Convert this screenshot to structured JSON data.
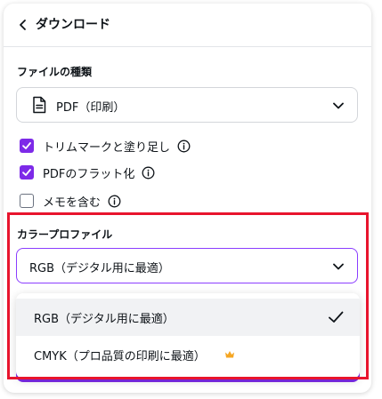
{
  "header": {
    "title": "ダウンロード",
    "back_icon": "chevron-left-icon"
  },
  "file_type": {
    "label": "ファイルの種類",
    "selected": "PDF（印刷）",
    "icon": "document-icon"
  },
  "options": [
    {
      "label": "トリムマークと塗り足し",
      "checked": true
    },
    {
      "label": "PDFのフラット化",
      "checked": true
    },
    {
      "label": "メモを含む",
      "checked": false
    }
  ],
  "color_profile": {
    "label": "カラープロファイル",
    "selected": "RGB（デジタル用に最適）",
    "dropdown": [
      {
        "label": "RGB（デジタル用に最適）",
        "selected": true
      },
      {
        "label": "CMYK（プロ品質の印刷に最適）",
        "premium": true
      }
    ]
  },
  "colors": {
    "accent": "#7d2ae8",
    "focus_border": "#8b3dff",
    "highlight": "#e8142d",
    "premium": "#f5a623"
  }
}
